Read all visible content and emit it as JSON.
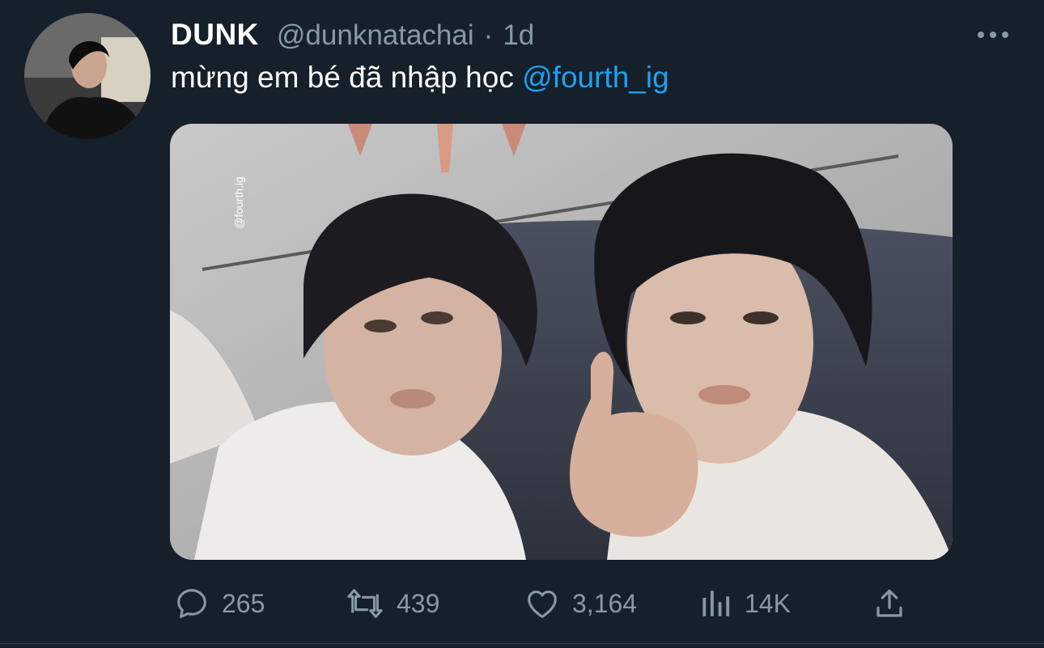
{
  "tweet": {
    "display_name": "DUNK",
    "handle": "@dunknatachai",
    "separator": "·",
    "time": "1d",
    "text": "mừng em bé đã nhập học ",
    "mention": "@fourth_ig",
    "media_watermark": "@fourth.ig"
  },
  "actions": {
    "replies": "265",
    "retweets": "439",
    "likes": "3,164",
    "views": "14K"
  },
  "icons": {
    "reply": "reply-icon",
    "retweet": "retweet-icon",
    "like": "heart-icon",
    "views": "analytics-icon",
    "share": "share-icon",
    "more": "more-horizontal-icon"
  },
  "colors": {
    "background": "#15202b",
    "secondary_text": "#8899a6",
    "link": "#1da1f2"
  }
}
